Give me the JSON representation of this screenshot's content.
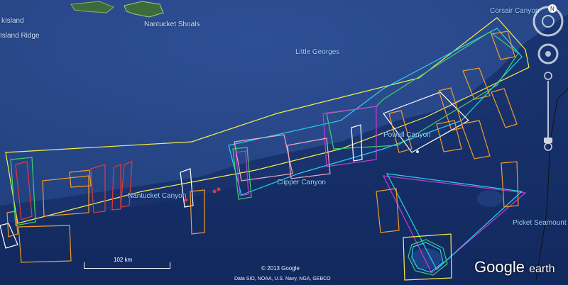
{
  "map": {
    "labels": {
      "island": "kIsland",
      "island_ridge": "Island Ridge",
      "nantucket_shoals": "Nantucket Shoals",
      "little_georges": "Little Georges",
      "corsair_canyon": "Corsair Canyon",
      "powell_canyon": "Powell Canyon",
      "clipper_canyon": "Clipper Canyon",
      "nantucket_canyon": "Nantucket Canyon",
      "picket_seamount": "Picket Seamount"
    },
    "scale_label": "102 km",
    "copyright": "© 2013 Google",
    "data_attribution": "Data SIO, NOAA, U.S. Navy, NGA, GEBCO",
    "brand_google": "Google",
    "brand_earth": "earth",
    "compass_letter": "N",
    "colors": {
      "ocean": "#1d3a7a",
      "shelf": "#2d4c8f",
      "yellow": "#f5f04a",
      "cyan": "#29d3f0",
      "green": "#3fd06a",
      "orange": "#f39b2a",
      "red": "#e03a3a",
      "magenta": "#c23bd4",
      "white": "#ffffff",
      "pink": "#f4a6c0"
    }
  }
}
